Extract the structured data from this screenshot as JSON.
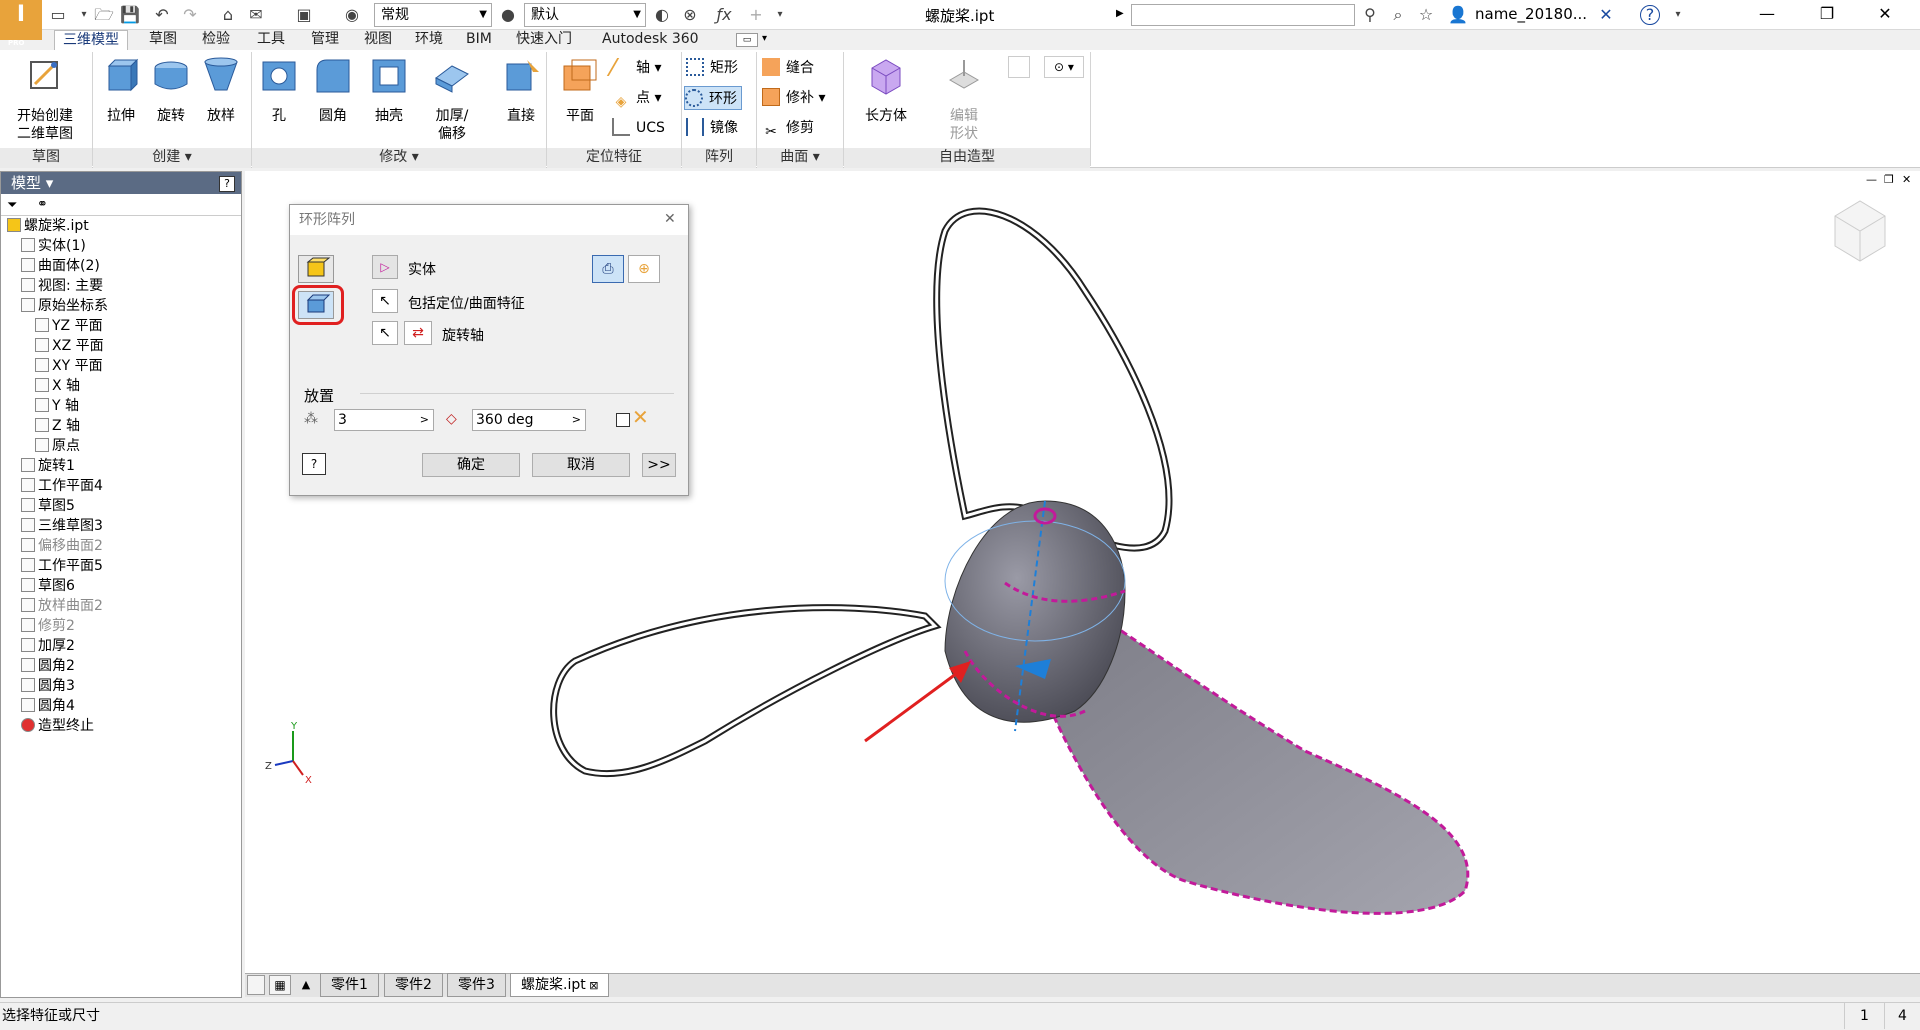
{
  "titlebar": {
    "app_icon_letter": "I",
    "app_badge": "PRO",
    "style_combo": "常规",
    "material_combo": "默认",
    "doc_title": "螺旋桨.ipt",
    "user": "name_20180...",
    "help": "?"
  },
  "tabs": [
    "三维模型",
    "草图",
    "检验",
    "工具",
    "管理",
    "视图",
    "环境",
    "BIM",
    "快速入门",
    "Autodesk 360"
  ],
  "ribbon": {
    "sketch": {
      "start_line1": "开始创建",
      "start_line2": "二维草图",
      "panel": "草图"
    },
    "create": {
      "extrude": "拉伸",
      "revolve": "旋转",
      "loft": "放样",
      "panel": "创建 ▾"
    },
    "modify": {
      "hole": "孔",
      "fillet": "圆角",
      "shell": "抽壳",
      "thicken_line1": "加厚/",
      "thicken_line2": "偏移",
      "panel": "修改 ▾"
    },
    "direct": {
      "label": "直接"
    },
    "work": {
      "plane": "平面",
      "axis": "轴",
      "point": "点",
      "ucs": "UCS",
      "panel": "定位特征"
    },
    "pattern": {
      "rect": "矩形",
      "circ": "环形",
      "mirror": "镜像",
      "panel": "阵列"
    },
    "surface": {
      "stitch": "缝合",
      "patch": "修补",
      "trim": "修剪",
      "panel": "曲面 ▾"
    },
    "freeform": {
      "box": "长方体",
      "edit_line1": "编辑",
      "edit_line2": "形状",
      "panel": "自由造型"
    }
  },
  "browser": {
    "title": "模型 ▾",
    "items": [
      {
        "label": "螺旋桨.ipt",
        "gray": false
      },
      {
        "label": "实体(1)",
        "gray": false
      },
      {
        "label": "曲面体(2)",
        "gray": false
      },
      {
        "label": "视图: 主要",
        "gray": false
      },
      {
        "label": "原始坐标系",
        "gray": false
      },
      {
        "label": "YZ 平面",
        "gray": false
      },
      {
        "label": "XZ 平面",
        "gray": false
      },
      {
        "label": "XY 平面",
        "gray": false
      },
      {
        "label": "X 轴",
        "gray": false
      },
      {
        "label": "Y 轴",
        "gray": false
      },
      {
        "label": "Z 轴",
        "gray": false
      },
      {
        "label": "原点",
        "gray": false
      },
      {
        "label": "旋转1",
        "gray": false
      },
      {
        "label": "工作平面4",
        "gray": false
      },
      {
        "label": "草图5",
        "gray": false
      },
      {
        "label": "三维草图3",
        "gray": false
      },
      {
        "label": "偏移曲面2",
        "gray": true
      },
      {
        "label": "工作平面5",
        "gray": false
      },
      {
        "label": "草图6",
        "gray": false
      },
      {
        "label": "放样曲面2",
        "gray": true
      },
      {
        "label": "修剪2",
        "gray": true
      },
      {
        "label": "加厚2",
        "gray": false
      },
      {
        "label": "圆角2",
        "gray": false
      },
      {
        "label": "圆角3",
        "gray": false
      },
      {
        "label": "圆角4",
        "gray": false
      },
      {
        "label": "造型终止",
        "gray": false
      }
    ]
  },
  "dialog": {
    "title": "环形阵列",
    "solid_label": "实体",
    "include_label": "包括定位/曲面特征",
    "axis_label": "旋转轴",
    "placement_label": "放置",
    "count_value": "3",
    "angle_value": "360 deg",
    "ok": "确定",
    "cancel": "取消",
    "more": ">>"
  },
  "doc_tabs": [
    "零件1",
    "零件2",
    "零件3",
    "螺旋桨.ipt"
  ],
  "status": {
    "prompt": "选择特征或尺寸",
    "num1": "1",
    "num2": "4"
  },
  "colors": {
    "accent": "#e8a33b",
    "highlight": "#c21a9a",
    "red_box": "#e02020",
    "panel_blue": "#5b6b84"
  }
}
